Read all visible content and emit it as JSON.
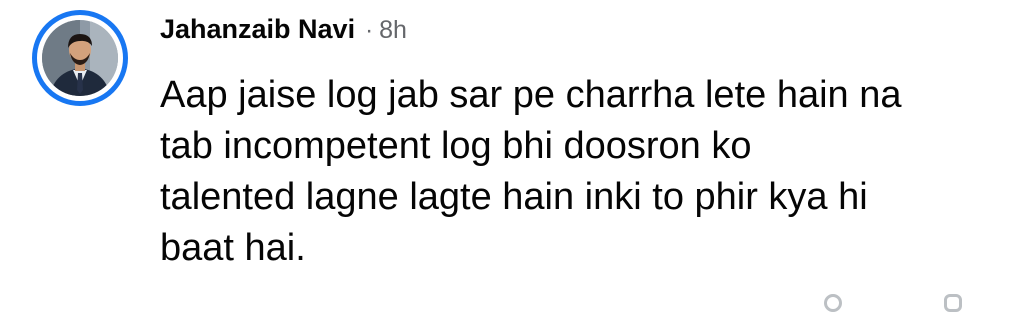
{
  "comment": {
    "author": "Jahanzaib Navi",
    "separator": "·",
    "time": "8h",
    "text": "Aap jaise log jab sar pe charrha lete hain na\ntab incompetent log bhi doosron ko\ntalented lagne lagte hain inki to phir kya hi\nbaat hai."
  },
  "colors": {
    "avatar_ring": "#1877f2",
    "author_text": "#050505",
    "meta_text": "#65676b",
    "body_text": "#050505"
  },
  "icons": {
    "avatar": "profile-photo",
    "bottom_actions": [
      "reaction-icon",
      "reply-icon"
    ]
  }
}
